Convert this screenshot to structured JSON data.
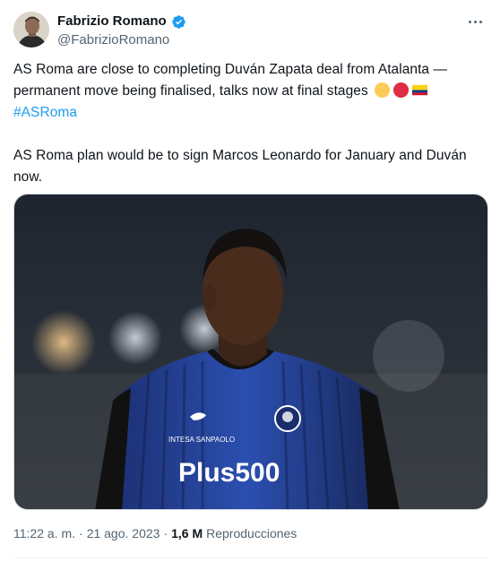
{
  "author": {
    "display_name": "Fabrizio Romano",
    "handle": "@FabrizioRomano",
    "verified_icon": "verified-badge-icon",
    "verified_color": "#1d9bf0"
  },
  "menu": {
    "icon": "more-horizontal-icon"
  },
  "tweet": {
    "paragraph1_line1": "AS Roma are close to completing Duván Zapata deal from Atalanta —",
    "paragraph1_line2": "permanent move being finalised, talks now at final stages",
    "emojis": [
      "yellow-circle-emoji",
      "red-circle-emoji",
      "colombia-flag-emoji"
    ],
    "hashtag": "#ASRoma",
    "paragraph2": "AS Roma plan would be to sign Marcos Leonardo for January and Duván now."
  },
  "media": {
    "description_icon": "photo-player-in-atalanta-kit",
    "sponsor_text": "Plus500",
    "sleeve_text": "INTESA SANPAOLO"
  },
  "meta": {
    "time": "11:22 a. m.",
    "separator": "·",
    "date": "21 ago. 2023",
    "views_count": "1,6 M",
    "views_label": "Reproducciones"
  },
  "colors": {
    "text_primary": "#0f1419",
    "text_secondary": "#536471",
    "link": "#1d9bf0",
    "border": "#cfd9de"
  }
}
